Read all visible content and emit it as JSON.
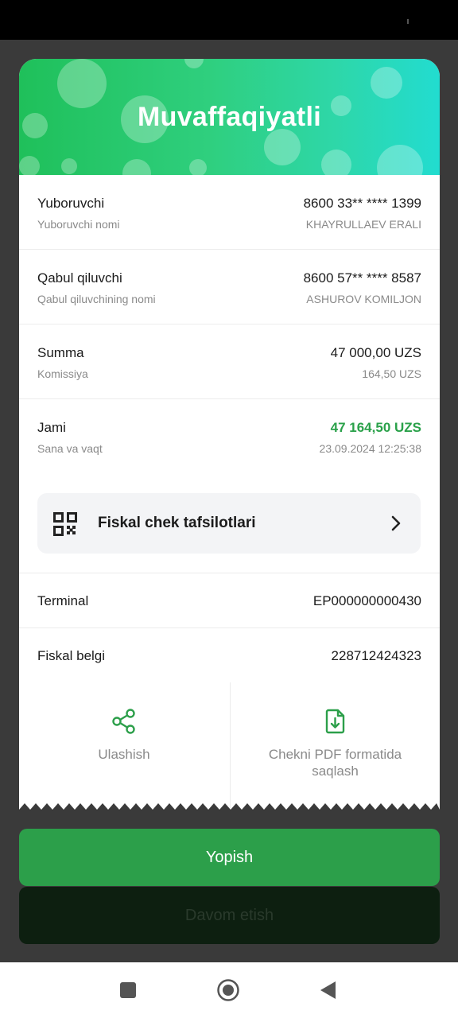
{
  "hero": {
    "title": "Muvaffaqiyatli"
  },
  "sender": {
    "label": "Yuboruvchi",
    "sub_label": "Yuboruvchi nomi",
    "card": "8600 33** **** 1399",
    "name": "KHAYRULLAEV ERALI"
  },
  "receiver": {
    "label": "Qabul qiluvchi",
    "sub_label": "Qabul qiluvchining nomi",
    "card": "8600 57** **** 8587",
    "name": "ASHUROV KOMILJON"
  },
  "amount": {
    "label": "Summa",
    "sub_label": "Komissiya",
    "value": "47 000,00 UZS",
    "commission": "164,50 UZS"
  },
  "total": {
    "label": "Jami",
    "sub_label": "Sana va vaqt",
    "value": "47 164,50 UZS",
    "datetime": "23.09.2024 12:25:38"
  },
  "fiscal_details": {
    "label": "Fiskal chek tafsilotlari"
  },
  "terminal": {
    "label": "Terminal",
    "value": "EP000000000430"
  },
  "fiscal_sign": {
    "label": "Fiskal belgi",
    "value": "228712424323"
  },
  "actions": {
    "share": "Ulashish",
    "save_pdf": "Chekni PDF formatida saqlash"
  },
  "buttons": {
    "close": "Yopish",
    "continue": "Davom etish"
  },
  "colors": {
    "accent_green": "#2c9f4a",
    "total_green": "#2aa14a",
    "hero_start": "#1fc05a",
    "hero_end": "#22dcd0"
  },
  "icons": {
    "qr": "qr-code-icon",
    "chevron": "chevron-right-icon",
    "share": "share-icon",
    "pdf": "file-download-icon",
    "nav_recent": "square-icon",
    "nav_home": "circle-icon",
    "nav_back": "triangle-back-icon"
  }
}
